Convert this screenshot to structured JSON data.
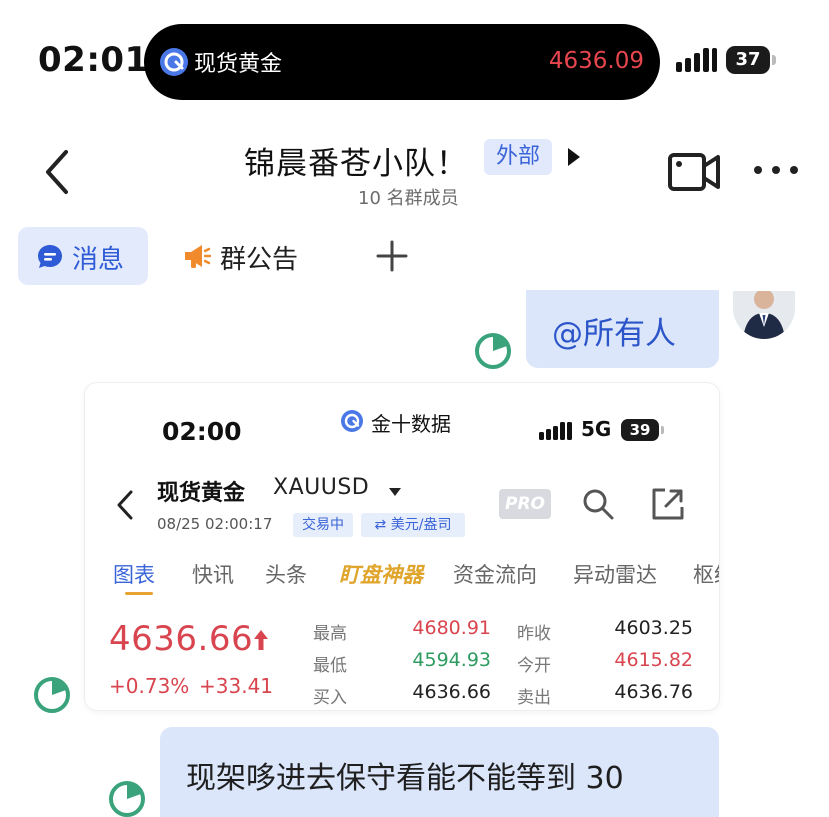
{
  "status_bar": {
    "time": "02:01",
    "island_app": "现货黄金",
    "island_price": "4636.09",
    "battery": "37"
  },
  "header": {
    "title": "锦晨番苍小队！",
    "tag": "外部",
    "member_count": "10 名群成员"
  },
  "tabs": {
    "messages": "消息",
    "announcement": "群公告"
  },
  "messages": [
    {
      "text": "@所有人"
    },
    {
      "text": "现架哆进去保守看能不能等到 30"
    }
  ],
  "screenshot": {
    "time": "02:00",
    "app_name": "金十数据",
    "network": "5G",
    "battery": "39",
    "instrument_name": "现货黄金",
    "instrument_code": "XAUUSD",
    "datetime": "08/25 02:00:17",
    "trading_status": "交易中",
    "currency": "⇄ 美元/盎司",
    "pro_badge": "PRO",
    "tabs": [
      "图表",
      "快讯",
      "头条",
      "盯盘神器",
      "资金流向",
      "异动雷达",
      "枢纽"
    ],
    "price": "4636.66",
    "change_pct": "+0.73%",
    "change_abs": "+33.41",
    "stats": {
      "high_label": "最高",
      "high": "4680.91",
      "low_label": "最低",
      "low": "4594.93",
      "bid_label": "买入",
      "bid": "4636.66",
      "prev_close_label": "昨收",
      "prev_close": "4603.25",
      "open_label": "今开",
      "open": "4615.82",
      "ask_label": "卖出",
      "ask": "4636.76"
    }
  },
  "colors": {
    "accent_blue": "#2f5cd6",
    "bubble_bg": "#dbe6fb",
    "price_red": "#d8454f",
    "price_green": "#2e9b61",
    "read_green": "#3aa37c"
  }
}
